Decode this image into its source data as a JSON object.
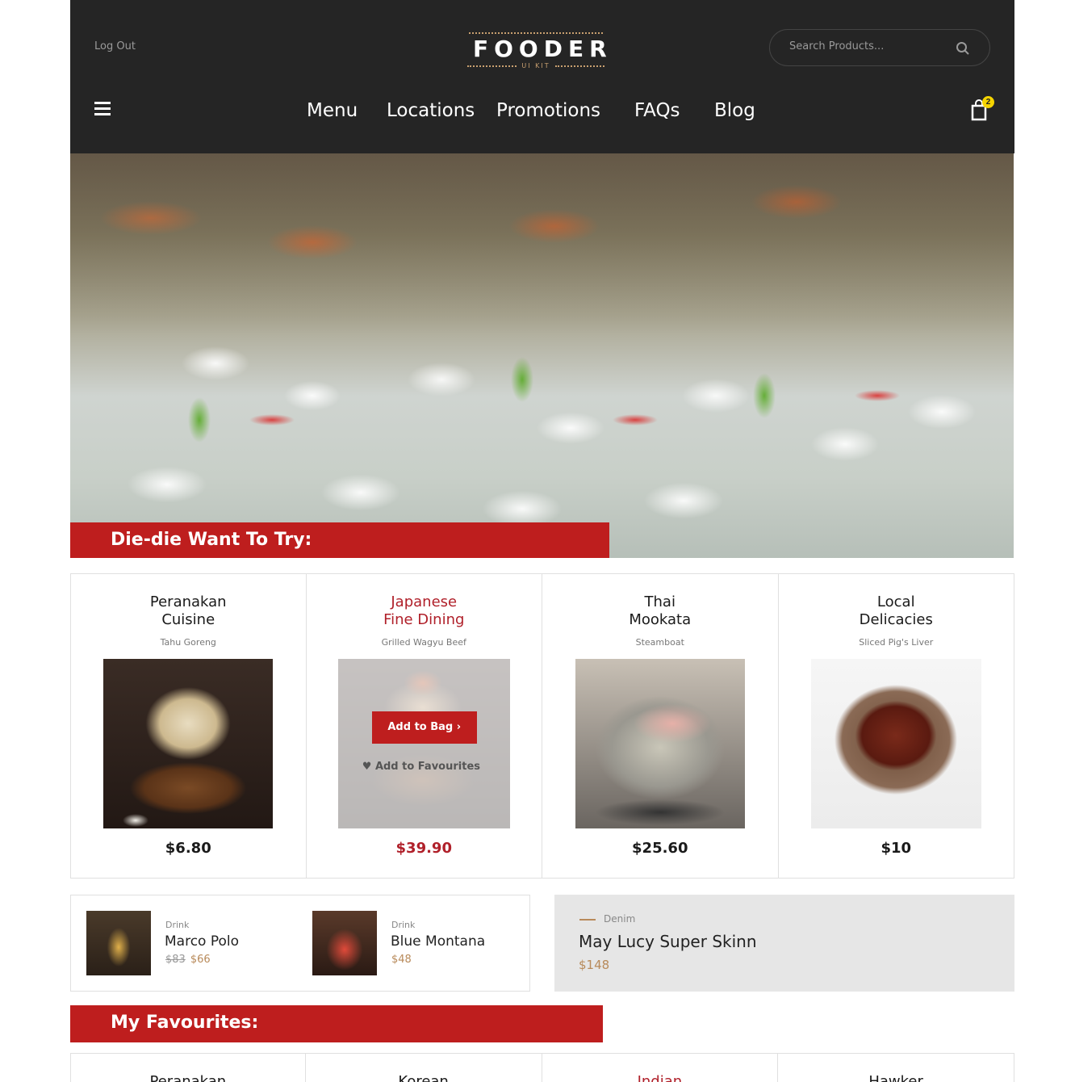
{
  "header": {
    "logout_label": "Log Out",
    "logo_text": "FOODER",
    "logo_sub": "UI KIT",
    "search_placeholder": "Search Products...",
    "nav": [
      "Menu",
      "Locations",
      "Promotions",
      "FAQs",
      "Blog"
    ],
    "cart_count": "2"
  },
  "hero": {
    "banner": "Die-die Want To Try:"
  },
  "featured": [
    {
      "title_line1": "Peranakan",
      "title_line2": "Cuisine",
      "dish": "Tahu Goreng",
      "price": "$6.80"
    },
    {
      "title_line1": "Japanese",
      "title_line2": "Fine Dining",
      "dish": "Grilled Wagyu Beef",
      "price": "$39.90",
      "add_to_bag": "Add to Bag",
      "add_to_favourites": "Add to Favourites"
    },
    {
      "title_line1": "Thai",
      "title_line2": "Mookata",
      "dish": "Steamboat",
      "price": "$25.60"
    },
    {
      "title_line1": "Local",
      "title_line2": "Delicacies",
      "dish": "Sliced Pig's Liver",
      "price": "$10"
    }
  ],
  "drinks": [
    {
      "category": "Drink",
      "name": "Marco Polo",
      "old_price": "$83",
      "price": "$66"
    },
    {
      "category": "Drink",
      "name": "Blue Montana",
      "price": "$48"
    }
  ],
  "promo": {
    "category": "Denim",
    "name": "May Lucy Super Skinn",
    "price": "$148"
  },
  "favourites": {
    "banner": "My Favourites:",
    "items": [
      "Peranakan",
      "Korean",
      "Indian",
      "Hawker"
    ]
  },
  "colors": {
    "header_bg": "#252525",
    "accent_red": "#be1e1e",
    "gold": "#c9a070",
    "badge": "#f5d400"
  }
}
